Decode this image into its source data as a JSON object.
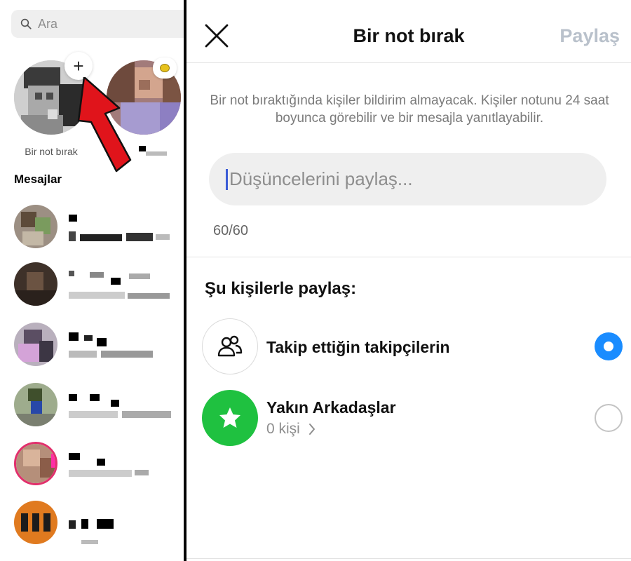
{
  "left": {
    "search": {
      "placeholder": "Ara"
    },
    "note_caption": "Bir not bırak",
    "note_plus": "+",
    "section_title": "Mesajlar"
  },
  "modal": {
    "title": "Bir not bırak",
    "share_label": "Paylaş",
    "info_text": "Bir not bıraktığında kişiler bildirim almayacak. Kişiler notunu 24 saat boyunca görebilir ve bir mesajla yanıtlayabilir.",
    "input_placeholder": "Düşüncelerini paylaş...",
    "counter": "60/60",
    "share_heading": "Şu kişilerle paylaş:",
    "options": [
      {
        "label": "Takip ettiğin takipçilerin",
        "icon": "people-icon",
        "selected": true
      },
      {
        "label": "Yakın Arkadaşlar",
        "sublabel": "0 kişi",
        "icon": "star-icon",
        "selected": false
      }
    ]
  },
  "colors": {
    "accent_blue": "#1a8cff",
    "close_friends_green": "#1fc140",
    "disabled_share": "#b9c1cb",
    "annotation_arrow": "#e0141b"
  }
}
